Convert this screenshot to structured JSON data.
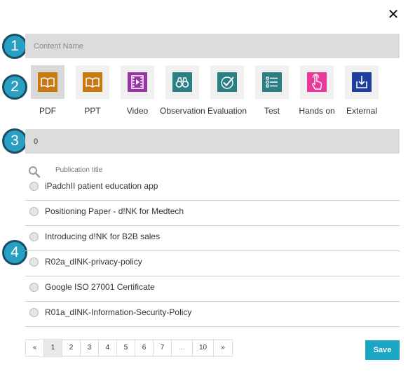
{
  "dialog": {
    "close_glyph": "✕"
  },
  "steps": [
    "1",
    "2",
    "3",
    "4"
  ],
  "content_name": {
    "value": "",
    "placeholder": "Content Name"
  },
  "content_types": [
    {
      "label": "PDF",
      "icon": "book-open-icon",
      "color": "#c8790f",
      "selected": true
    },
    {
      "label": "PPT",
      "icon": "book-open-icon",
      "color": "#c8790f",
      "selected": false
    },
    {
      "label": "Video",
      "icon": "film-play-icon",
      "color": "#9a35a8",
      "selected": false
    },
    {
      "label": "Observation",
      "icon": "binoculars-icon",
      "color": "#2a7f84",
      "selected": false
    },
    {
      "label": "Evaluation",
      "icon": "checkmark-icon",
      "color": "#2a7f84",
      "selected": false
    },
    {
      "label": "Test",
      "icon": "list-icon",
      "color": "#2a7f84",
      "selected": false
    },
    {
      "label": "Hands on",
      "icon": "touch-hand-icon",
      "color": "#e8389a",
      "selected": false
    },
    {
      "label": "External",
      "icon": "download-tray-icon",
      "color": "#1d3fa0",
      "selected": false
    }
  ],
  "number_field": {
    "value": "0"
  },
  "publication_search": {
    "placeholder": "Publication title",
    "value": ""
  },
  "publications": [
    "iPadchII patient education app",
    "Positioning Paper - d!NK for Medtech",
    "Introducing d!NK for B2B sales",
    "R02a_dINK-privacy-policy",
    "Google ISO 27001 Certificate",
    "R01a_dINK-Information-Security-Policy"
  ],
  "pagination": {
    "items": [
      "«",
      "1",
      "2",
      "3",
      "4",
      "5",
      "6",
      "7",
      "...",
      "10",
      "»"
    ],
    "active_index": 1
  },
  "save_button": {
    "label": "Save",
    "color": "#1aa7c6"
  },
  "accent": {
    "badge": "#2a9fc4",
    "badge_border": "#1b4d63"
  }
}
